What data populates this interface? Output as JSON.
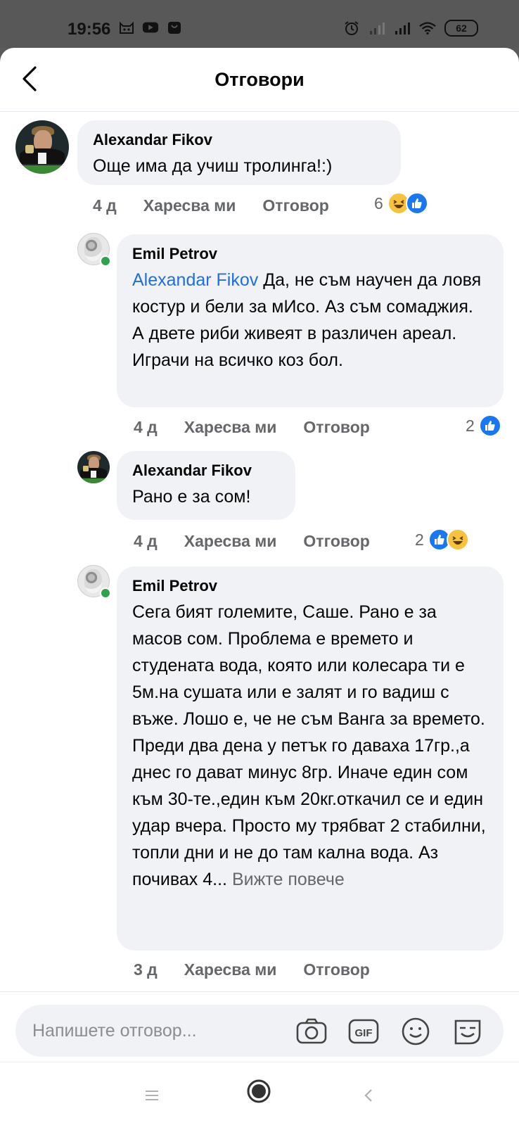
{
  "status_bar": {
    "time": "19:56",
    "battery": "62"
  },
  "header": {
    "title": "Отговори"
  },
  "comments": [
    {
      "author": "Alexandar Fikov",
      "text": "Още има да учиш тролинга!:)",
      "age": "4 д",
      "like_label": "Харесва ми",
      "reply_label": "Отговор",
      "reaction_count": "6",
      "reactions": [
        "haha",
        "like"
      ]
    },
    {
      "author": "Emil Petrov",
      "mention": "Alexandar Fikov",
      "text": "Да, не съм научен да ловя костур и бели за мИсо. Аз съм сомаджия. А двете риби живеят в различен ареал. Играчи на всичко коз бол.",
      "age": "4 д",
      "like_label": "Харесва ми",
      "reply_label": "Отговор",
      "reaction_count": "2",
      "reactions": [
        "like"
      ]
    },
    {
      "author": "Alexandar Fikov",
      "text": "Рано е за сом!",
      "age": "4 д",
      "like_label": "Харесва ми",
      "reply_label": "Отговор",
      "reaction_count": "2",
      "reactions": [
        "like",
        "haha"
      ]
    },
    {
      "author": "Emil Petrov",
      "text": "Сега бият големите, Саше. Рано е за масов сом. Проблема е времето и студената вода, която или колесара ти е 5м.на сушата или е залят и го вадиш с въже. Лошо е, че не съм Ванга за времето. Преди два дена у петък го даваха 17гр.,а днес го дават минус 8гр. Иначе един сом към 30-те.,един към 20кг.откачил се и един удар вчера. Просто му трябват 2 стабилни, топли дни и не до там кална вода. Аз почивах 4...",
      "see_more": "Вижте повече",
      "age": "3 д",
      "like_label": "Харесва ми",
      "reply_label": "Отговор"
    }
  ],
  "composer": {
    "placeholder": "Напишете отговор...",
    "icons": [
      "camera-icon",
      "gif-icon",
      "emoji-icon",
      "sticker-icon"
    ]
  },
  "nav": {
    "icons": [
      "menu-icon",
      "home-icon",
      "back-icon"
    ]
  },
  "colors": {
    "mention": "#216fdb",
    "bubble": "#f0f2f5",
    "like": "#1877f2",
    "online": "#31a24c"
  }
}
